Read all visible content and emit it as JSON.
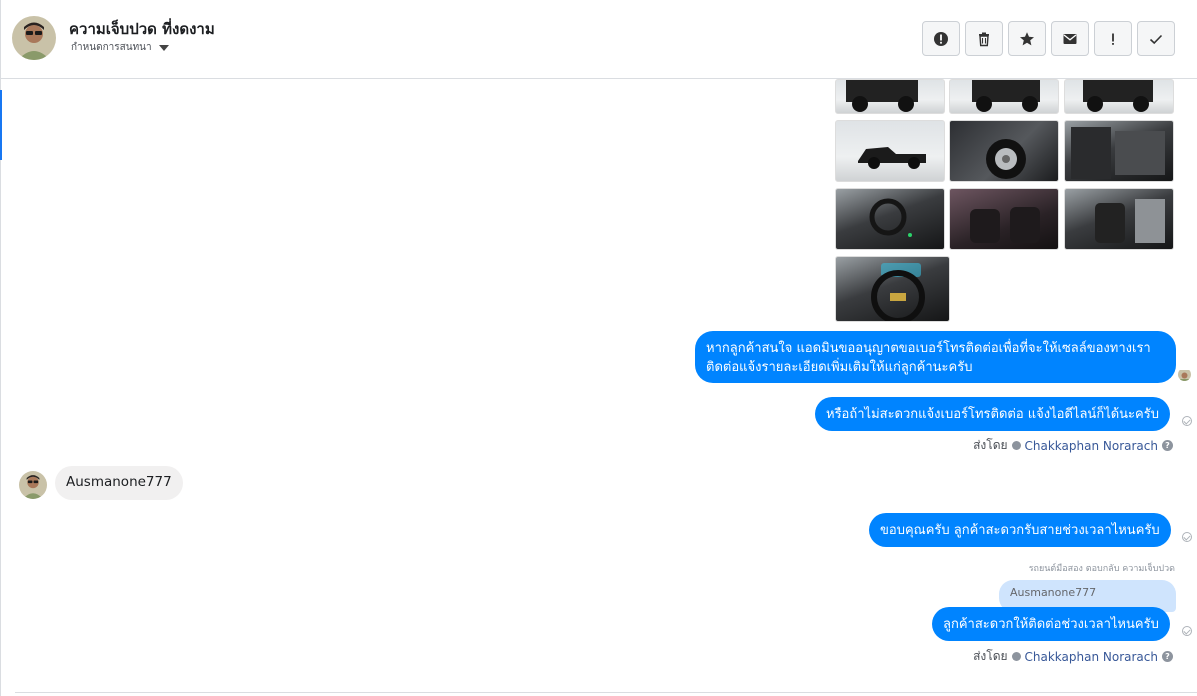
{
  "header": {
    "contact_name": "ความเจ็บปวด ที่งดงาม",
    "subtitle": "กำหนดการสนทนา",
    "toolbar": {
      "alert_icon": "exclamation-circle-icon",
      "delete_icon": "trash-icon",
      "star_icon": "star-icon",
      "mail_icon": "envelope-icon",
      "spam_icon": "exclamation-icon",
      "done_icon": "check-icon"
    }
  },
  "messages": {
    "out_1": "หากลูกค้าสนใจ แอดมินขออนุญาตขอเบอร์โทรติดต่อเพื่อที่จะให้เซลล์ของทางเรา",
    "out_1b": "ติดต่อแจ้งรายละเอียดเพิ่มเติมให้แก่ลูกค้านะครับ",
    "out_2": "หรือถ้าไม่สะดวกแจ้งเบอร์โทรติดต่อ แจ้งไอดีไลน์ก็ได้นะครับ",
    "sent_by_1": {
      "prefix": "ส่งโดย",
      "name": "Chakkaphan Norarach"
    },
    "in_1": "Ausmanone777",
    "out_3": "ขอบคุณครับ ลูกค้าสะดวกรับสายช่วงเวลาไหนครับ",
    "reply_label": "รถยนต์มือสอง ตอบกลับ ความเจ็บปวด",
    "quoted": "Ausmanone777",
    "out_4": "ลูกค้าสะดวกให้ติดต่อช่วงเวลาไหนครับ",
    "sent_by_2": {
      "prefix": "ส่งโดย",
      "name": "Chakkaphan Norarach"
    }
  },
  "colors": {
    "outgoing_bubble": "#0084ff",
    "incoming_bubble": "#f1f0f0",
    "quote_bubble": "#cfe4fd",
    "accent": "#1877f2"
  }
}
